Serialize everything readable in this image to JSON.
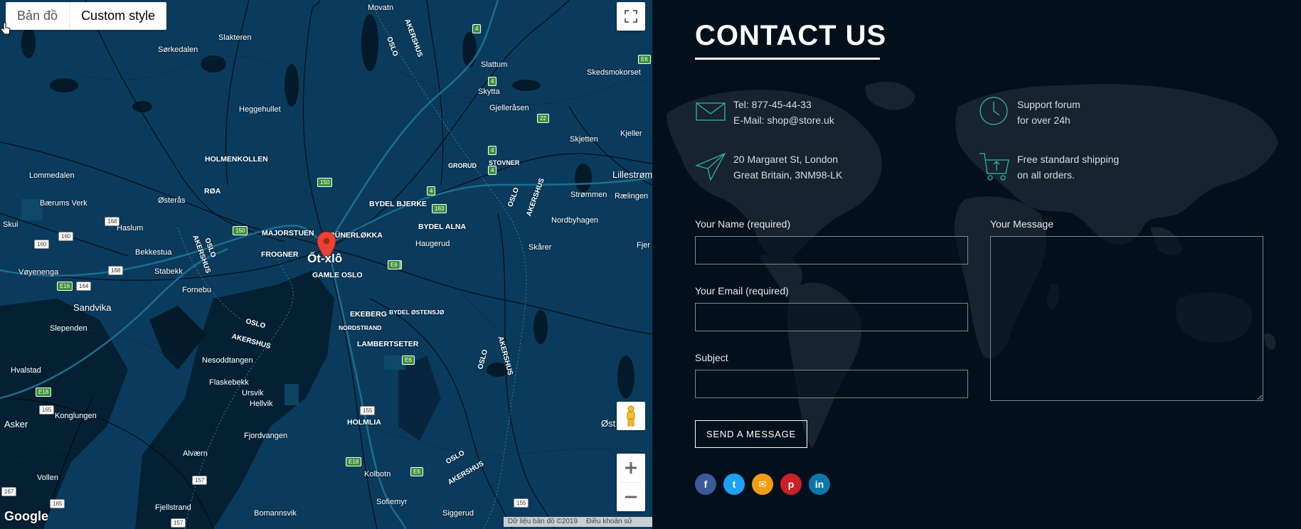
{
  "map": {
    "type_buttons": [
      "Bản đồ",
      "Custom style"
    ],
    "google_logo": "Google",
    "attribution": "Dữ liệu bản đồ ©2019",
    "terms": "Điều khoản sử dụng",
    "pin_label": "Ốt-xlô",
    "labels": [
      "Movatn",
      "Slakteren",
      "Sørkedalen",
      "Slattum",
      "Skedsmokorset",
      "Skytta",
      "Heggehullet",
      "Gjelleråsen",
      "Kjeller",
      "Skjetten",
      "HOLMENKOLLEN",
      "GRORUD",
      "STOVNER",
      "Lillestrøm",
      "Lommedalen",
      "RØA",
      "Strømmen",
      "Rælingen",
      "Bærums Verk",
      "Østerås",
      "BYDEL BJERKE",
      "Nordbyhagen",
      "Skui",
      "Haslum",
      "MAJORSTUEN",
      "GRÜNERLØKKA",
      "BYDEL ALNA",
      "Haugerud",
      "Skårer",
      "Fjer",
      "Bekkestua",
      "FROGNER",
      "Vøyenenga",
      "Stabekk",
      "GAMLE OSLO",
      "Fornebu",
      "Sandvika",
      "EKEBERG",
      "BYDEL ØSTENSJØ",
      "NORDSTRAND",
      "Slependen",
      "LAMBERTSETER",
      "Hvalstad",
      "Nesoddtangen",
      "Flaskebekk",
      "Ursvik",
      "Hellvik",
      "Konglungen",
      "Asker",
      "HOLMLIA",
      "Fjordvangen",
      "Alværn",
      "Kolbotn",
      "Vollen",
      "Fjellstrand",
      "Sofiemyr",
      "Bomannsvik",
      "Siggerud",
      "Øst",
      "OSLO",
      "AKERSHUS"
    ],
    "shields": [
      "4",
      "4",
      "4",
      "22",
      "4",
      "4",
      "150",
      "163",
      "168",
      "150",
      "160",
      "160",
      "168",
      "E16",
      "164",
      "E6",
      "E6",
      "E18",
      "E18",
      "155",
      "165",
      "E6",
      "157",
      "165",
      "157",
      "167",
      "E6",
      "155",
      "E6"
    ]
  },
  "contact": {
    "title": "CONTACT US",
    "info": [
      {
        "icon": "envelope-icon",
        "line1": "Tel: 877-45-44-33",
        "line2": "E-Mail: shop@store.uk"
      },
      {
        "icon": "clock-icon",
        "line1": "Support forum",
        "line2": "for over 24h"
      },
      {
        "icon": "paper-plane-icon",
        "line1": "20 Margaret St, London",
        "line2": "Great Britain, 3NM98-LK"
      },
      {
        "icon": "cart-icon",
        "line1": "Free standard shipping",
        "line2": "on all orders."
      }
    ],
    "form": {
      "name_label": "Your Name (required)",
      "email_label": "Your Email (required)",
      "subject_label": "Subject",
      "message_label": "Your Message",
      "name_value": "",
      "email_value": "",
      "subject_value": "",
      "message_value": "",
      "submit_label": "SEND A MESSAGE"
    },
    "social": [
      {
        "name": "facebook",
        "glyph": "f",
        "color": "#3b5998"
      },
      {
        "name": "twitter",
        "glyph": "t",
        "color": "#1da1f2"
      },
      {
        "name": "email",
        "glyph": "✉",
        "color": "#f39c12"
      },
      {
        "name": "pinterest",
        "glyph": "p",
        "color": "#cb2027"
      },
      {
        "name": "linkedin",
        "glyph": "in",
        "color": "#0e76a8"
      }
    ]
  }
}
